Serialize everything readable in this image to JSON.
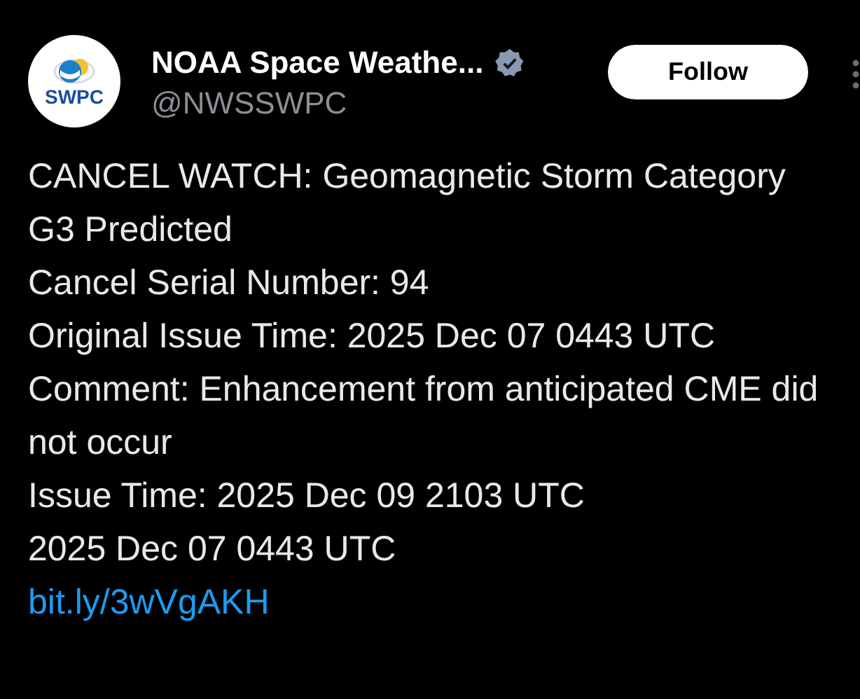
{
  "author": {
    "logo_text": "SWPC",
    "name": "NOAA Space Weathe...",
    "verified": true,
    "handle": "@NWSSWPC"
  },
  "follow_button": "Follow",
  "post": {
    "lines": [
      "CANCEL WATCH: Geomagnetic Storm Category G3 Predicted",
      "Cancel Serial Number: 94",
      "Original Issue Time: 2025 Dec 07 0443 UTC",
      "Comment: Enhancement from anticipated CME did not occur",
      "Issue Time: 2025 Dec 09 2103 UTC",
      "2025 Dec 07 0443 UTC"
    ],
    "link": "bit.ly/3wVgAKH"
  }
}
